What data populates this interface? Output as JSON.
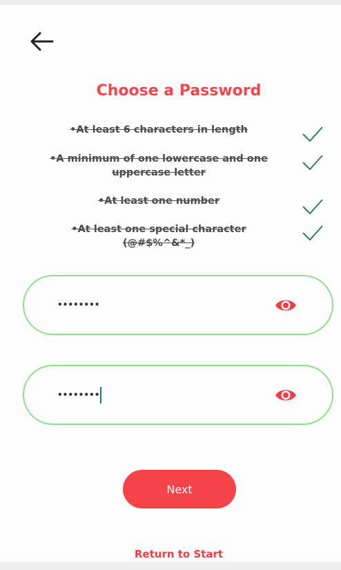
{
  "header": {
    "back_icon": "arrow-left-icon",
    "title": "Choose a Password"
  },
  "requirements": [
    {
      "text": "•At least 6 characters in length",
      "met": true
    },
    {
      "text": "•A minimum of one lowercase and one uppercase letter",
      "met": true
    },
    {
      "text": "•At least one number",
      "met": true
    },
    {
      "text": "•At least one special character (@#$%^&*_)",
      "met": true
    }
  ],
  "password": {
    "masked_value": "••••••••",
    "visibility_icon": "eye-icon"
  },
  "confirm_password": {
    "masked_value": "••••••••",
    "visibility_icon": "eye-icon",
    "focused": true
  },
  "actions": {
    "next_label": "Next",
    "return_label": "Return to Start"
  },
  "colors": {
    "accent": "#f5434a",
    "field_border": "#8ee08a",
    "check": "#2f7d6a"
  }
}
